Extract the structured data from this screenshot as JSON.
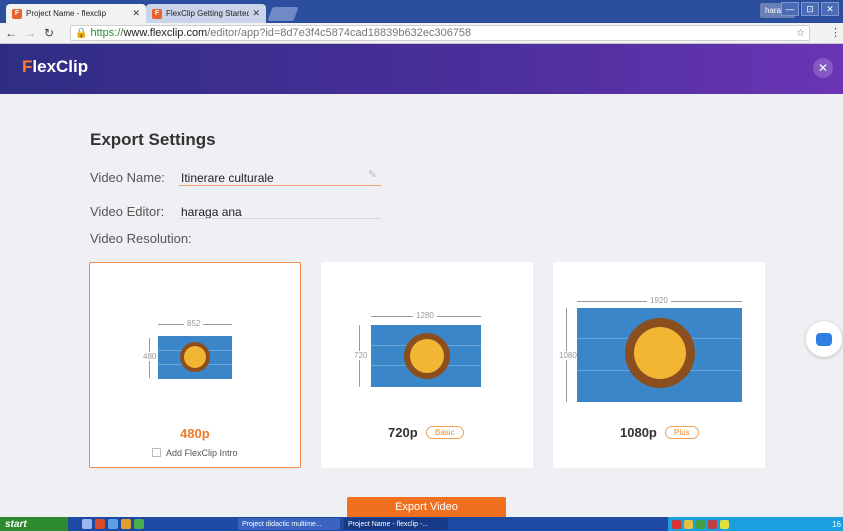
{
  "browser": {
    "tabs": [
      {
        "favicon": "F",
        "label": "Project Name - flexclip"
      },
      {
        "favicon": "F",
        "label": "FlexClip Getting Started Tut"
      }
    ],
    "profile": "haraga",
    "window_buttons": [
      "—",
      "⊡",
      "✕"
    ],
    "url_secure": "https://",
    "url_host": "www.flexclip.com",
    "url_path": "/editor/app?id=8d7e3f4c5874cad18839b632ec306758"
  },
  "app": {
    "logo_first": "F",
    "logo_rest": "lexClip",
    "close_icon": "✕"
  },
  "export": {
    "title": "Export Settings",
    "video_name_label": "Video Name:",
    "video_name_value": "Itinerare culturale",
    "video_editor_label": "Video Editor:",
    "video_editor_value": "haraga ana",
    "video_resolution_label": "Video Resolution:",
    "options": [
      {
        "width": "852",
        "height": "480",
        "label": "480p",
        "selected": true
      },
      {
        "width": "1280",
        "height": "720",
        "label": "720p",
        "badge": "Basic"
      },
      {
        "width": "1920",
        "height": "1080",
        "label": "1080p",
        "badge": "Plus"
      }
    ],
    "intro_checkbox_label": "Add FlexClip Intro",
    "export_button": "Export Video"
  },
  "taskbar": {
    "start": "start",
    "tasks": [
      "Project didactic multime...",
      "Project Name - flexclip -..."
    ],
    "clock": "16"
  },
  "colors": {
    "accent": "#f07020",
    "header_start": "#2f2d83",
    "header_end": "#6a35b5",
    "thumb_blue": "#3a86c8"
  }
}
